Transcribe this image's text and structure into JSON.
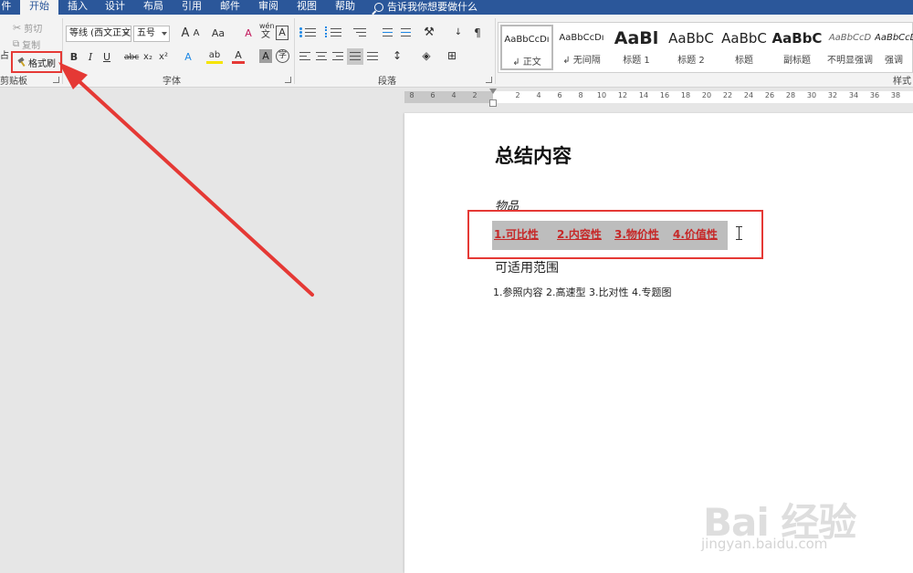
{
  "tabs": [
    {
      "label": "件",
      "active": false
    },
    {
      "label": "开始",
      "active": true
    },
    {
      "label": "插入",
      "active": false
    },
    {
      "label": "设计",
      "active": false
    },
    {
      "label": "布局",
      "active": false
    },
    {
      "label": "引用",
      "active": false
    },
    {
      "label": "邮件",
      "active": false
    },
    {
      "label": "审阅",
      "active": false
    },
    {
      "label": "视图",
      "active": false
    },
    {
      "label": "帮助",
      "active": false
    }
  ],
  "tell_me": "告诉我你想要做什么",
  "clipboard": {
    "cut_label": "剪切",
    "copy_label": "复制",
    "format_painter_label": "格式刷",
    "paste_fragment": "占",
    "group_label": "剪贴板"
  },
  "font_group": {
    "font_name": "等线 (西文正文)",
    "font_size": "五号",
    "group_label": "字体",
    "bold": "B",
    "italic": "I",
    "underline": "U",
    "strikethrough": "abc",
    "subscript": "x₂",
    "superscript": "x²",
    "grow": "A",
    "shrink": "A",
    "change_case": "Aa",
    "clear_format": "A",
    "char_border": "A",
    "text_effect": "A",
    "highlight": "ab",
    "font_color": "A",
    "shading": "A",
    "enclosed": "字",
    "phonetic": "wén",
    "phonetic_char": "文"
  },
  "paragraph_group": {
    "group_label": "段落"
  },
  "styles_group": {
    "group_label": "样式",
    "items": [
      {
        "preview": "AaBbCcDı",
        "name": "↲ 正文",
        "selected": true
      },
      {
        "preview": "AaBbCcDı",
        "name": "↲ 无间隔",
        "selected": false
      },
      {
        "preview": "AaBl",
        "name": "标题 1",
        "selected": false
      },
      {
        "preview": "AaBbC",
        "name": "标题 2",
        "selected": false
      },
      {
        "preview": "AaBbC",
        "name": "标题",
        "selected": false
      },
      {
        "preview": "AaBbC",
        "name": "副标题",
        "selected": false
      },
      {
        "preview": "AaBbCcD",
        "name": "不明显强调",
        "selected": false
      },
      {
        "preview": "AaBbCcD",
        "name": "强调",
        "selected": false
      }
    ]
  },
  "ruler": {
    "ticks": [
      "8",
      "6",
      "4",
      "2",
      "2",
      "4",
      "6",
      "8",
      "10",
      "12",
      "14",
      "16",
      "18",
      "20",
      "22",
      "24",
      "26",
      "28",
      "30",
      "32",
      "34",
      "36",
      "38"
    ]
  },
  "document": {
    "title": "总结内容",
    "subtitle": "物品",
    "selected_items": [
      "1.可比性",
      "2.内容性",
      "3.物价性",
      "4.价值性"
    ],
    "heading2": "可适用范围",
    "list_line": "1.参照内容 2.高速型   3.比对性 4.专题图"
  },
  "watermark": {
    "main": "Bai 经验",
    "sub": "jingyan.baidu.com"
  },
  "colors": {
    "title_bar": "#2b579a",
    "annotation_red": "#e53935",
    "selection_text": "#c62828"
  }
}
